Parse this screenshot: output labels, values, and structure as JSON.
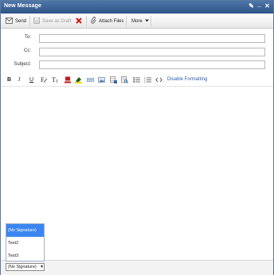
{
  "window": {
    "title": "New Message"
  },
  "title_controls": {
    "pin_glyph": "✎",
    "minimize_glyph": "_",
    "close_glyph": "✕"
  },
  "toolbar": {
    "send_label": "Send",
    "save_draft_label": "Save as Draft",
    "attach_label": "Attach Files",
    "more_label": "More"
  },
  "fields": {
    "to_label": "To:",
    "cc_label": "Cc:",
    "subject_label": "Subject:",
    "to_value": "",
    "cc_value": "",
    "subject_value": ""
  },
  "format_bar": {
    "bold": "B",
    "italic": "I",
    "underline": "U",
    "disable_formatting_label": "Disable Formatting"
  },
  "signature": {
    "selected": "(No Signature)",
    "options": [
      "(No Signature)",
      "Test2",
      "Test3"
    ]
  },
  "colors": {
    "titlebar": "#3a5f92",
    "accent": "#3a86f0",
    "link": "#2b5fa8",
    "delete": "#d01818"
  }
}
